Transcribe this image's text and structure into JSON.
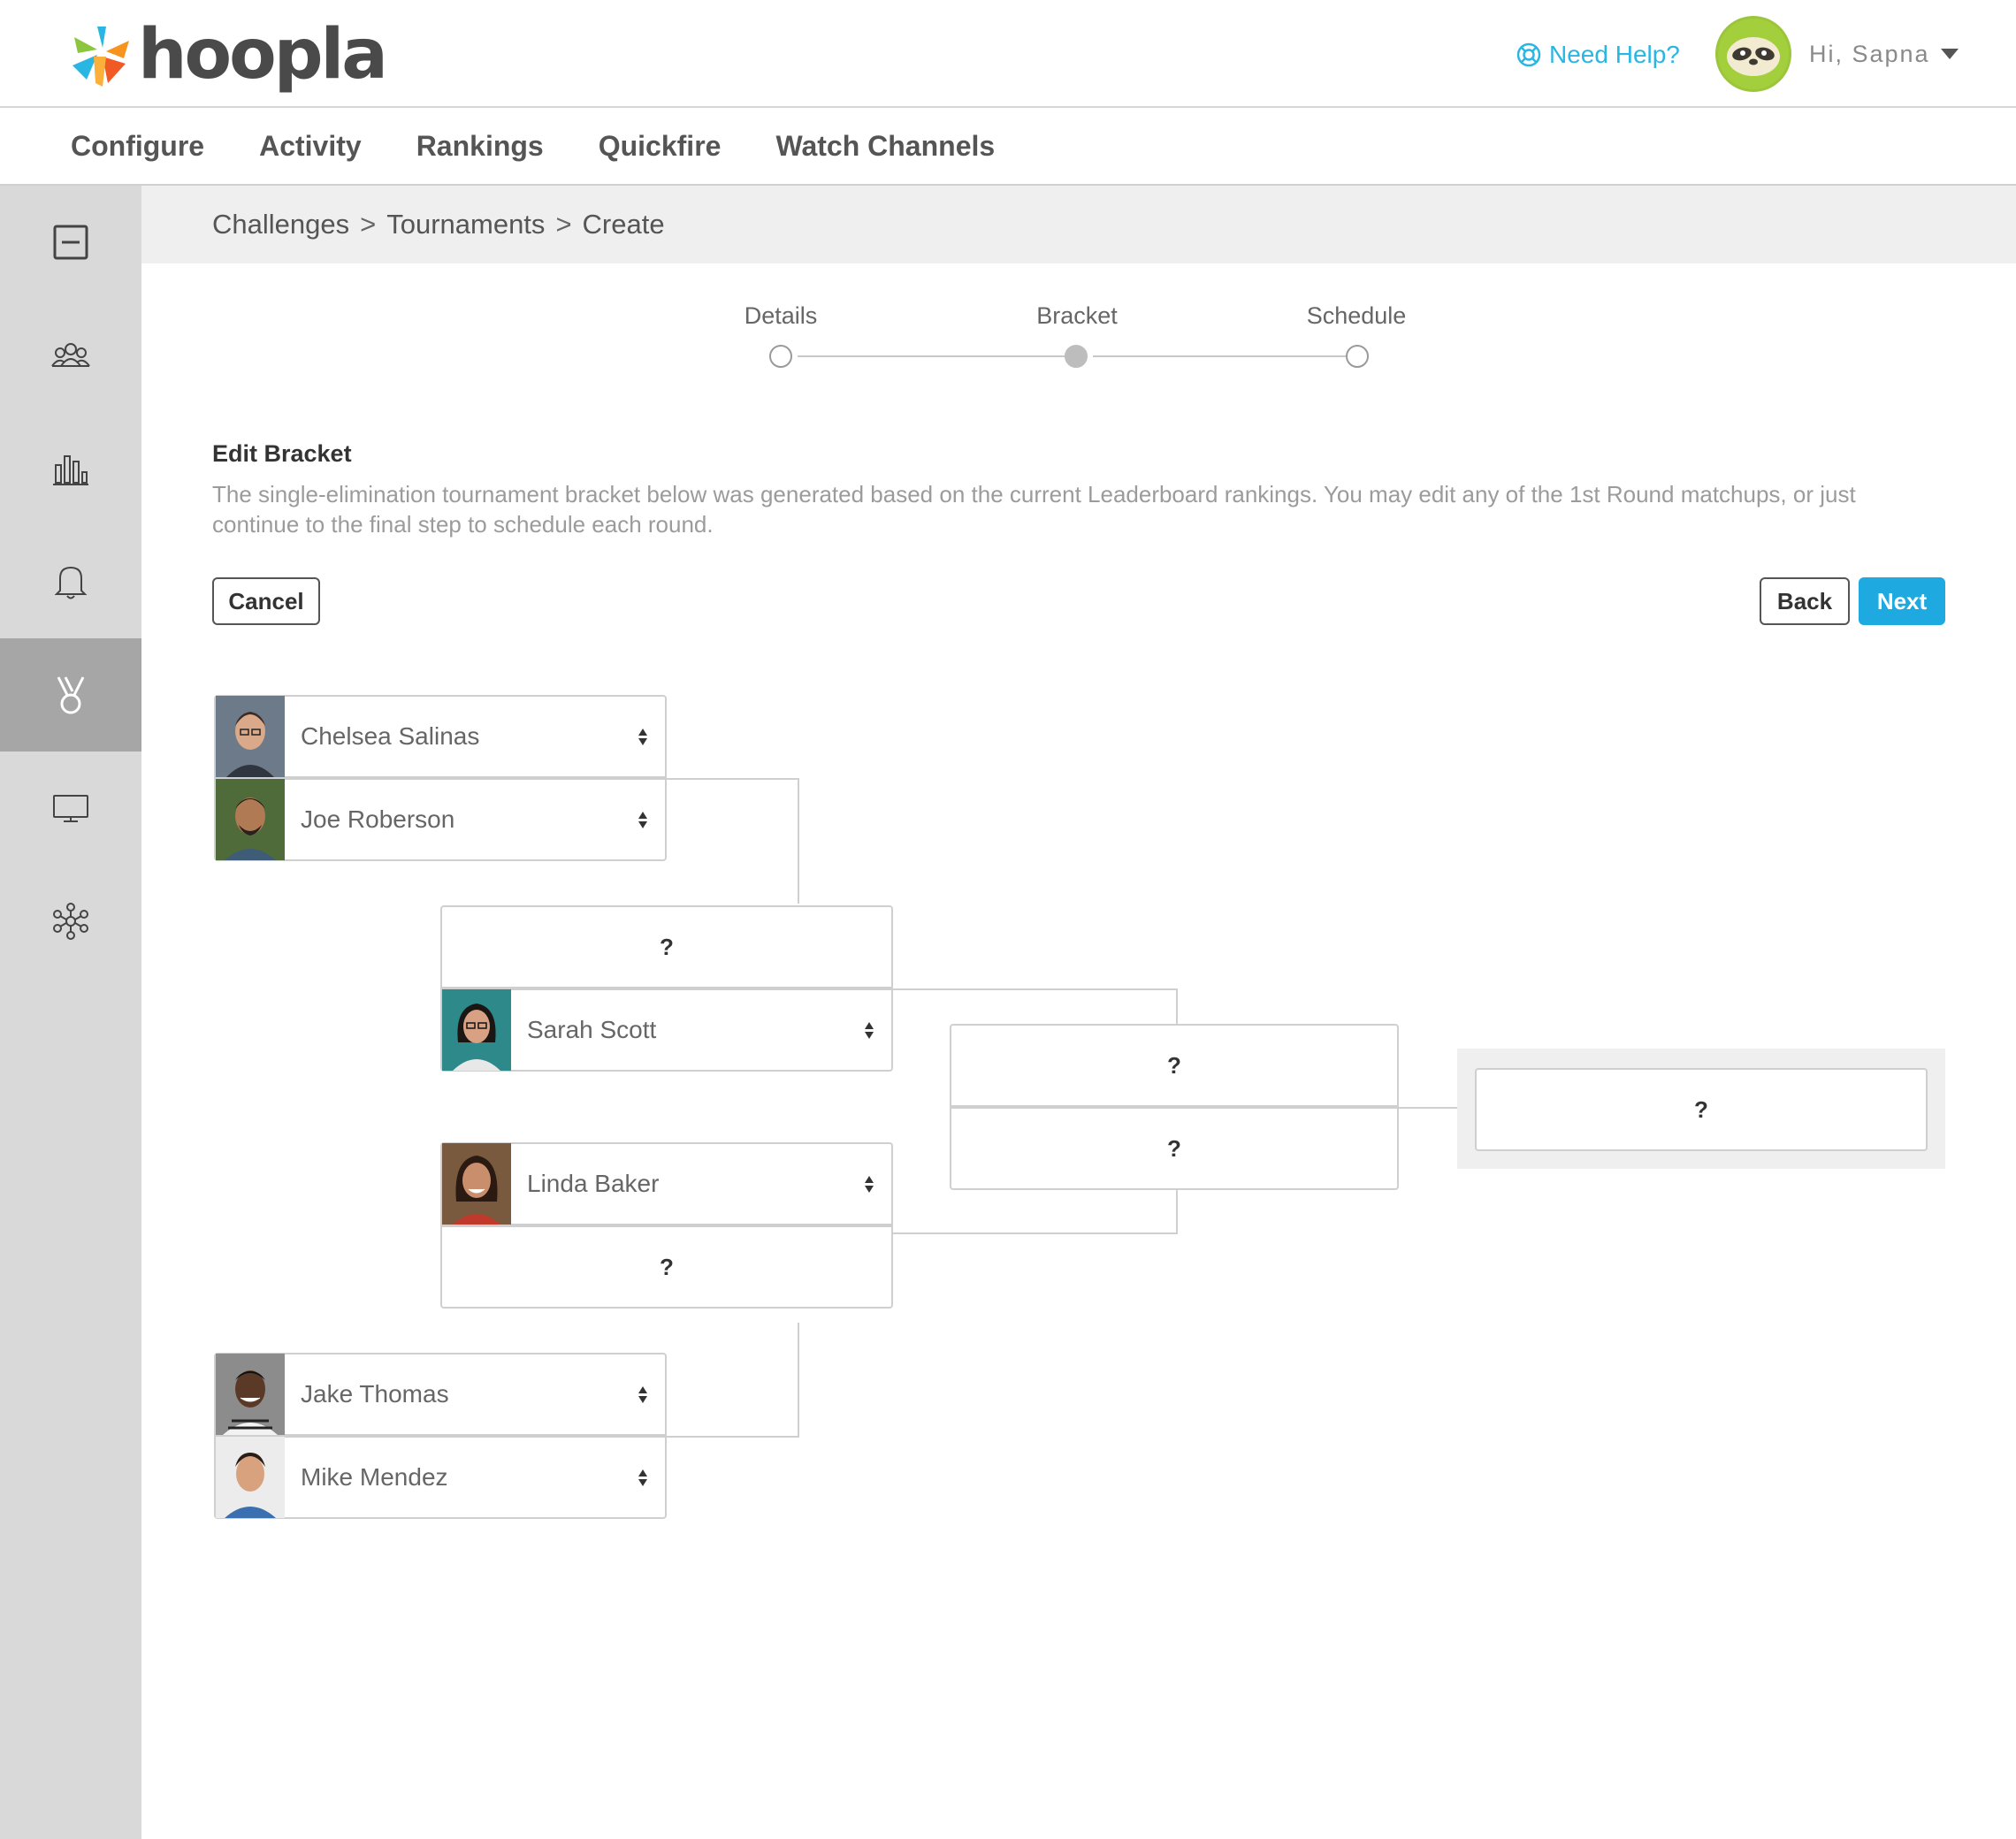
{
  "header": {
    "logo_text": "hoopla",
    "help_label": "Need Help?",
    "greeting": "Hi, Sapna"
  },
  "nav": {
    "items": [
      {
        "label": "Configure"
      },
      {
        "label": "Activity"
      },
      {
        "label": "Rankings"
      },
      {
        "label": "Quickfire"
      },
      {
        "label": "Watch Channels"
      }
    ]
  },
  "sidebar": {
    "items": [
      {
        "icon": "dashboard-icon"
      },
      {
        "icon": "team-icon"
      },
      {
        "icon": "bar-chart-icon"
      },
      {
        "icon": "bell-icon"
      },
      {
        "icon": "medal-icon",
        "active": true
      },
      {
        "icon": "monitor-icon"
      },
      {
        "icon": "network-icon"
      }
    ]
  },
  "breadcrumb": {
    "items": [
      "Challenges",
      "Tournaments",
      "Create"
    ],
    "separator": ">"
  },
  "stepper": {
    "steps": [
      {
        "label": "Details"
      },
      {
        "label": "Bracket",
        "current": true
      },
      {
        "label": "Schedule"
      }
    ]
  },
  "section": {
    "title": "Edit Bracket",
    "description": "The single-elimination tournament bracket below was generated based on the current Leaderboard rankings.  You may edit any of the 1st Round matchups, or just continue to the final step to schedule each round."
  },
  "buttons": {
    "cancel": "Cancel",
    "back": "Back",
    "next": "Next"
  },
  "bracket": {
    "round1": [
      {
        "name": "Chelsea Salinas"
      },
      {
        "name": "Joe Roberson"
      },
      {
        "name": "Jake Thomas"
      },
      {
        "name": "Mike Mendez"
      }
    ],
    "round2": [
      {
        "name": "?"
      },
      {
        "name": "Sarah Scott"
      },
      {
        "name": "Linda Baker"
      },
      {
        "name": "?"
      }
    ],
    "round3": [
      {
        "name": "?"
      },
      {
        "name": "?"
      }
    ],
    "final": {
      "name": "?"
    }
  },
  "colors": {
    "accent": "#1ea9e1",
    "help_link": "#29b6e3",
    "sidebar_bg": "#d9d9d9",
    "sidebar_active": "#a6a6a6"
  }
}
